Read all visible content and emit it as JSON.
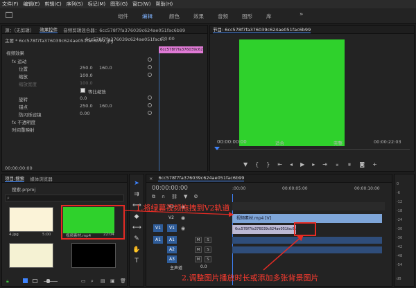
{
  "menu": [
    "文件(F)",
    "编辑(E)",
    "剪辑(C)",
    "序列(S)",
    "标记(M)",
    "图形(G)",
    "窗口(W)",
    "帮助(H)"
  ],
  "workspaces": [
    "组件",
    "编辑",
    "颜色",
    "效果",
    "音频",
    "图形",
    "库"
  ],
  "more": "»",
  "source_panel": {
    "tabs": [
      "源：（无剪辑）",
      "效果控件",
      "音频剪辑混合器：6cc578f7fa376039c624ae051fac6b99"
    ],
    "master": "主要 * 6cc578f7fa376039c624ae051fac6b99.jpg",
    "clip": "6cc578f7fa376039c624ae051fac6...",
    "clip_tag": "6cc578f7fa376039c624ae...",
    "timecode_top": "00:00",
    "video_effects": "视频效果",
    "motion": "运动",
    "position": "位置",
    "pos_x": "250.0",
    "pos_y": "160.0",
    "scale": "缩放",
    "scale_v": "100.0",
    "scale_w": "缩放宽度",
    "scale_w_v": "100.0",
    "uniform": "等比缩放",
    "rotation": "旋转",
    "rotation_v": "0.0",
    "anchor": "锚点",
    "anchor_x": "250.0",
    "anchor_y": "160.0",
    "flicker": "防闪烁滤镜",
    "flicker_v": "0.00",
    "opacity": "不透明度",
    "remap": "时间重映射",
    "timecode": "00:00:00:00"
  },
  "program": {
    "title": "节目: 6cc578f7fa376039c624ae051fac6b99",
    "timecode": "00:00:00:00",
    "fit": "适合",
    "quality": "完整",
    "duration": "00:00:22:03"
  },
  "project": {
    "tabs": [
      "项目:搜索",
      "媒体浏览器"
    ],
    "name": "搜索.prproj",
    "items": [
      {
        "label": "4.jpg",
        "duration": "5:00"
      },
      {
        "label": "视频素材.mp4",
        "duration": "22:04"
      },
      {
        "label": "",
        "duration": ""
      },
      {
        "label": "",
        "duration": ""
      }
    ]
  },
  "timeline": {
    "title": "6cc578f7fa376039c624ae051fac6b99",
    "timecode": "00:00:00:00",
    "ruler": [
      ":00:00",
      "00:00:05:00",
      "00:00:10:00"
    ],
    "tracks": [
      "V3",
      "V2",
      "V1",
      "A1",
      "A2",
      "A3",
      "主声道"
    ],
    "master_vol": "0.0",
    "clip_v2": "视频素材.mp4 [V]",
    "clip_v1": "6cc578f7fa376039c624ae051fac6b99.jpg",
    "src_v1": "V1",
    "src_a1": "A1",
    "track_buttons": {
      "m": "M",
      "s": "S"
    }
  },
  "annotations": {
    "one": "1.将绿幕视频拖拽到V2轨道",
    "two": "2.调整图片播放时长或添加多张背景图片"
  },
  "meter": [
    "0",
    "-6",
    "-12",
    "-18",
    "-24",
    "-30",
    "-36",
    "-42",
    "-48",
    "-54",
    "dB"
  ]
}
